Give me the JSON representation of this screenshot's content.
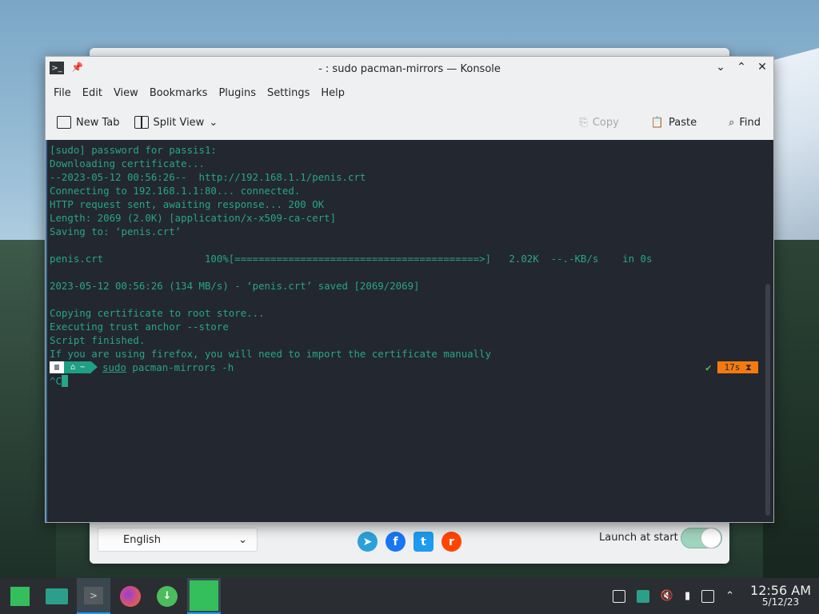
{
  "colors": {
    "accent": "#1d99f3",
    "terminal_bg": "#232730",
    "terminal_fg": "#27a58a",
    "timer_orange": "#f47a0f",
    "manjaro_green": "#35bf5c"
  },
  "window": {
    "title": "- : sudo pacman-mirrors — Konsole",
    "menu": [
      "File",
      "Edit",
      "View",
      "Bookmarks",
      "Plugins",
      "Settings",
      "Help"
    ],
    "toolbar": {
      "new_tab": "New Tab",
      "split_view": "Split View",
      "copy": "Copy",
      "paste": "Paste",
      "find": "Find"
    }
  },
  "terminal": {
    "lines": [
      "[sudo] password for passis1:",
      "Downloading certificate...",
      "--2023-05-12 00:56:26--  http://192.168.1.1/penis.crt",
      "Connecting to 192.168.1.1:80... connected.",
      "HTTP request sent, awaiting response... 200 OK",
      "Length: 2069 (2.0K) [application/x-x509-ca-cert]",
      "Saving to: ‘penis.crt’",
      "",
      "penis.crt                 100%[=========================================>]   2.02K  --.-KB/s    in 0s",
      "",
      "2023-05-12 00:56:26 (134 MB/s) - ‘penis.crt’ saved [2069/2069]",
      "",
      "Copying certificate to root store...",
      "Executing trust anchor --store",
      "Script finished.",
      "If you are using firefox, you will need to import the certificate manually"
    ],
    "prompt_seg1": "▥",
    "prompt_seg2": "⌂ ~",
    "command_sudo": "sudo",
    "command_rest": " pacman-mirrors -h",
    "status_check": "✔",
    "timer": "17s ⧗",
    "interrupt": "^C"
  },
  "welcome": {
    "language": "English",
    "launch_label": "Launch at start"
  },
  "taskbar": {
    "time": "12:56 AM",
    "date": "5/12/23"
  }
}
